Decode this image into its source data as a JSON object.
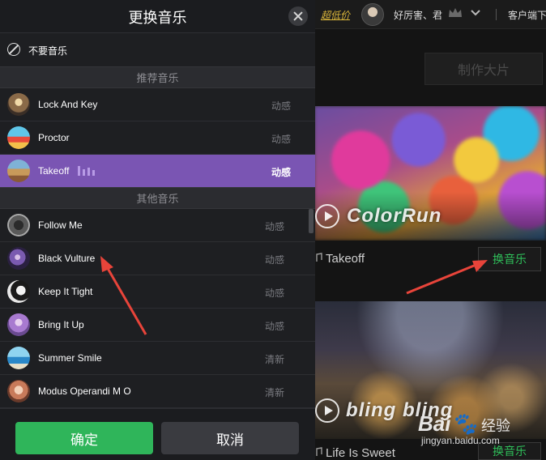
{
  "background": {
    "topbar": {
      "promo_text": "超低价",
      "username": "好厉害、君",
      "client_link": "客户端下"
    },
    "make_button": "制作大片",
    "cards": [
      {
        "overlay_title": "ColorRun",
        "track_name": "Takeoff",
        "swap_label": "换音乐"
      },
      {
        "overlay_title": "bling bling",
        "track_name": "Life Is Sweet",
        "swap_label": "换音乐"
      }
    ],
    "watermark": {
      "logo": "Bai",
      "cn": "经验",
      "url": "jingyan.baidu.com"
    }
  },
  "dialog": {
    "title": "更换音乐",
    "no_music_label": "不要音乐",
    "recommended_header": "推荐音乐",
    "other_header": "其他音乐",
    "recommended": [
      {
        "title": "Lock And Key",
        "tag": "动感",
        "thumb": "thumb-crowd"
      },
      {
        "title": "Proctor",
        "tag": "动感",
        "thumb": "thumb-pagoda"
      },
      {
        "title": "Takeoff",
        "tag": "动感",
        "thumb": "thumb-field",
        "selected": true,
        "playing": true
      }
    ],
    "other": [
      {
        "title": "Follow Me",
        "tag": "动感",
        "thumb": "thumb-plant"
      },
      {
        "title": "Black Vulture",
        "tag": "动感",
        "thumb": "thumb-party"
      },
      {
        "title": "Keep It Tight",
        "tag": "动感",
        "thumb": "thumb-face"
      },
      {
        "title": "Bring It Up",
        "tag": "动感",
        "thumb": "thumb-purple"
      },
      {
        "title": "Summer Smile",
        "tag": "清新",
        "thumb": "thumb-sea"
      },
      {
        "title": "Modus Operandi M O",
        "tag": "清新",
        "thumb": "thumb-girl"
      }
    ],
    "ok_label": "确定",
    "cancel_label": "取消"
  },
  "colors": {
    "selected_row": "#7a55b3",
    "ok_button": "#2fb55a",
    "swap_text": "#2fbf5a",
    "annotation_arrow": "#e8443a"
  }
}
